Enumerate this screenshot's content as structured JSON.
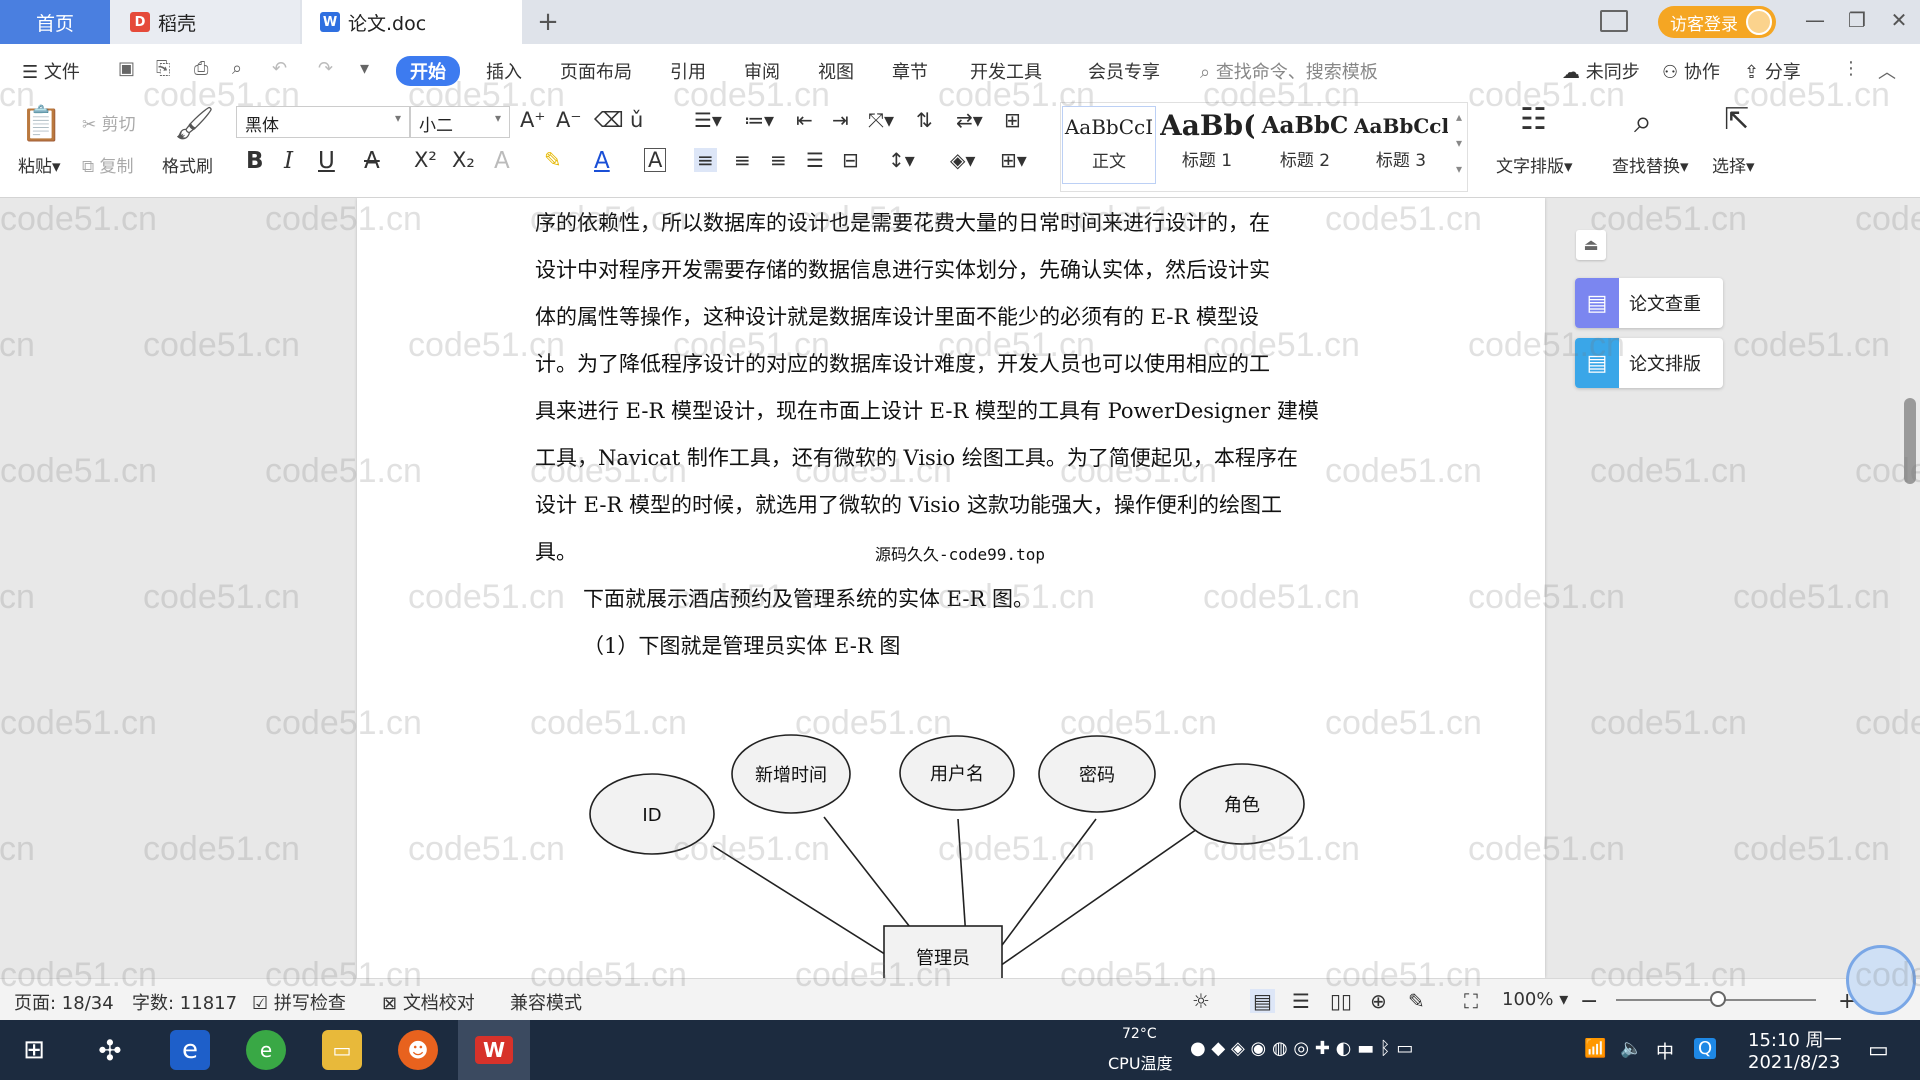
{
  "tabs": [
    {
      "label": "首页"
    },
    {
      "label": "稻壳"
    },
    {
      "label": "论文.doc"
    }
  ],
  "titlebar": {
    "login_label": "访客登录"
  },
  "menu": {
    "file": "文件",
    "items": [
      "开始",
      "插入",
      "页面布局",
      "引用",
      "审阅",
      "视图",
      "章节",
      "开发工具",
      "会员专享"
    ],
    "search_placeholder": "查找命令、搜索模板",
    "sync": "未同步",
    "collab": "协作",
    "share": "分享"
  },
  "ribbon": {
    "paste": "粘贴",
    "cut": "剪切",
    "copy": "复制",
    "format_painter": "格式刷",
    "font_name": "黑体",
    "font_size": "小二",
    "styles": [
      {
        "sample": "AaBbCcI",
        "label": "正文"
      },
      {
        "sample": "AaBb(",
        "label": "标题 1"
      },
      {
        "sample": "AaBbC",
        "label": "标题 2"
      },
      {
        "sample": "AaBbCcl",
        "label": "标题 3"
      }
    ],
    "text_layout": "文字排版",
    "find_replace": "查找替换",
    "select": "选择"
  },
  "document": {
    "lines": [
      "序的依赖性，所以数据库的设计也是需要花费大量的日常时间来进行设计的，在",
      "设计中对程序开发需要存储的数据信息进行实体划分，先确认实体，然后设计实",
      "体的属性等操作，这种设计就是数据库设计里面不能少的必须有的 E-R 模型设",
      "计。为了降低程序设计的对应的数据库设计难度，开发人员也可以使用相应的工",
      "具来进行 E-R 模型设计，现在市面上设计 E-R 模型的工具有 PowerDesigner 建模",
      "工具，Navicat 制作工具，还有微软的 Visio 绘图工具。为了简便起见，本程序在",
      "设计 E-R 模型的时候，就选用了微软的 Visio 这款功能强大，操作便利的绘图工",
      "具。"
    ],
    "source_note": "源码久久-code99.top",
    "intro": "下面就展示酒店预约及管理系统的实体 E-R 图。",
    "caption": "（1）下图就是管理员实体 E-R 图",
    "diagram": {
      "attributes": [
        "ID",
        "新增时间",
        "用户名",
        "密码",
        "角色"
      ],
      "entity": "管理员"
    }
  },
  "side_panel": {
    "check": "论文查重",
    "layout": "论文排版"
  },
  "status": {
    "page": "页面: 18/34",
    "words": "字数: 11817",
    "spell": "拼写检查",
    "proof": "文档校对",
    "compat": "兼容模式",
    "zoom": "100%"
  },
  "taskbar": {
    "cpu_temp": "72°C",
    "cpu_label": "CPU温度",
    "ime": "中",
    "time": "15:10 周一",
    "date": "2021/8/23"
  },
  "watermark": "code51.cn",
  "colors": {
    "accent": "#3d7bf0",
    "login": "#f5a623",
    "taskbar": "#1c2b3f"
  }
}
